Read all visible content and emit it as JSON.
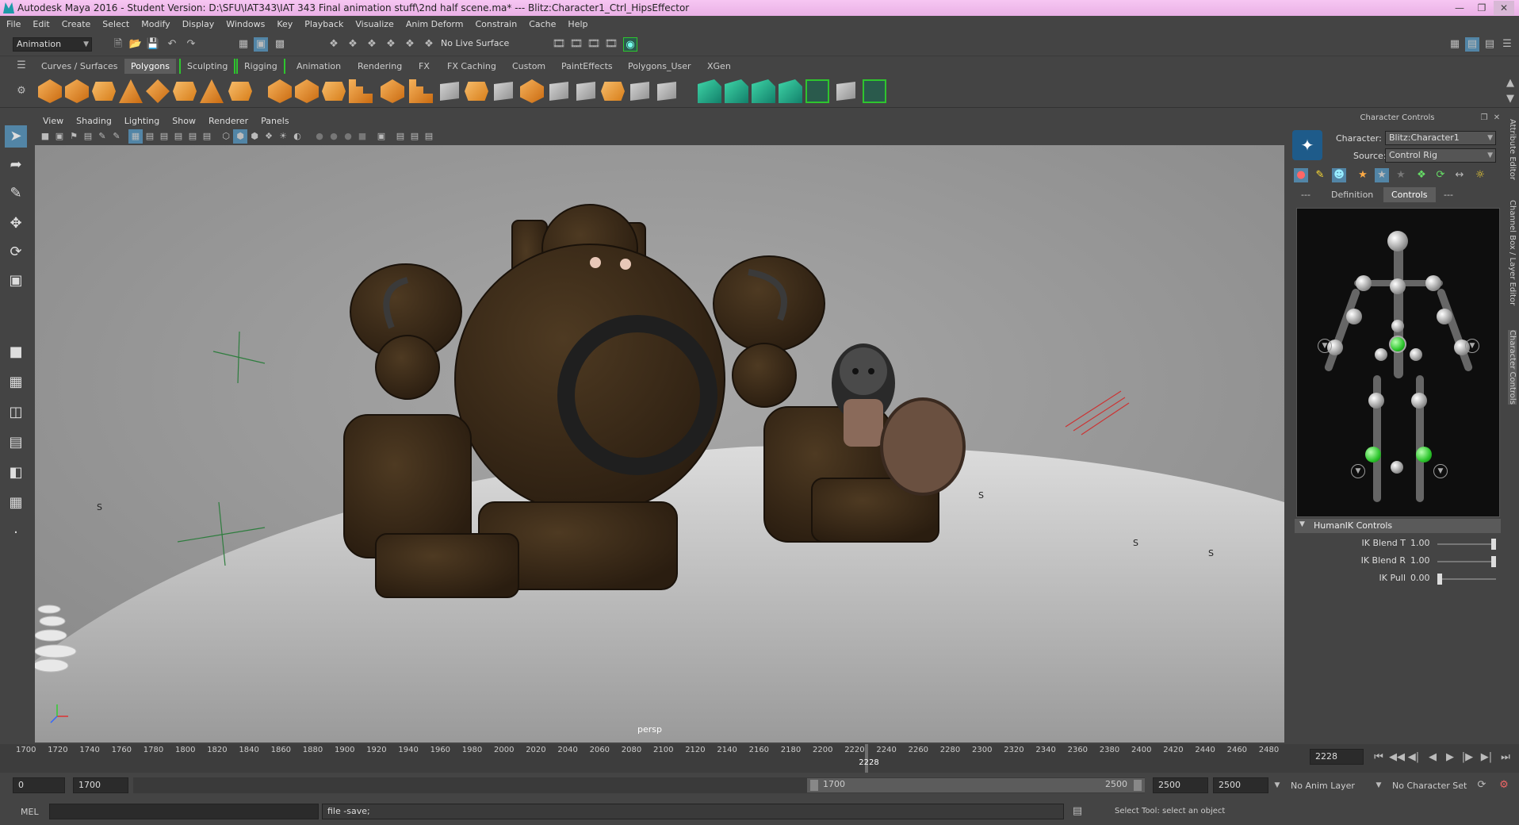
{
  "title": {
    "text": "Autodesk Maya 2016 - Student Version: D:\\SFU\\IAT343\\IAT 343 Final animation stuff\\2nd half scene.ma*   ---   Blitz:Character1_Ctrl_HipsEffector"
  },
  "menu": [
    "File",
    "Edit",
    "Create",
    "Select",
    "Modify",
    "Display",
    "Windows",
    "Key",
    "Playback",
    "Visualize",
    "Anim Deform",
    "Constrain",
    "Cache",
    "Help"
  ],
  "status": {
    "menuset": "Animation",
    "live_surface": "No Live Surface"
  },
  "shelf_tabs": [
    "Curves / Surfaces",
    "Polygons",
    "Sculpting",
    "Rigging",
    "Animation",
    "Rendering",
    "FX",
    "FX Caching",
    "Custom",
    "PaintEffects",
    "Polygons_User",
    "XGen"
  ],
  "shelf_active": "Polygons",
  "viewport": {
    "menu": [
      "View",
      "Shading",
      "Lighting",
      "Show",
      "Renderer",
      "Panels"
    ],
    "camera_label": "persp",
    "scene_markers": [
      "S",
      "S",
      "S",
      "S"
    ]
  },
  "character_controls": {
    "panel_title": "Character Controls",
    "character_label": "Character:",
    "character_value": "Blitz:Character1",
    "source_label": "Source:",
    "source_value": "Control Rig",
    "tabs": [
      "---",
      "Definition",
      "Controls",
      "---"
    ],
    "active_tab": "Controls",
    "section": "HumanIK Controls",
    "sliders": [
      {
        "label": "IK Blend T",
        "value": "1.00",
        "level": 1.0
      },
      {
        "label": "IK Blend R",
        "value": "1.00",
        "level": 1.0
      },
      {
        "label": "IK Pull",
        "value": "0.00",
        "level": 0.0
      }
    ]
  },
  "side_tabs": [
    "Attribute Editor",
    "Channel Box / Layer Editor",
    "Character Controls"
  ],
  "timeline": {
    "ticks": [
      "1700",
      "1720",
      "1740",
      "1760",
      "1780",
      "1800",
      "1820",
      "1840",
      "1860",
      "1880",
      "1900",
      "1920",
      "1940",
      "1960",
      "1980",
      "2000",
      "2020",
      "2040",
      "2060",
      "2080",
      "2100",
      "2120",
      "2140",
      "2160",
      "2180",
      "2200",
      "2220",
      "2240",
      "2260",
      "2280",
      "2300",
      "2320",
      "2340",
      "2360",
      "2380",
      "2400",
      "2420",
      "2440",
      "2460",
      "2480"
    ],
    "current_frame": "2228",
    "current_frame_field": "2228"
  },
  "range": {
    "start": "0",
    "playback_start": "1700",
    "slider_start": "1700",
    "slider_end": "2500",
    "playback_end": "2500",
    "end": "2500",
    "anim_layer": "No Anim Layer",
    "character_set": "No Character Set"
  },
  "command": {
    "mode": "MEL",
    "output": "file -save;",
    "help": "Select Tool: select an object"
  },
  "colors": {
    "titlebar": "#f0bcec",
    "accent": "#5285a6",
    "green": "#2ec52e",
    "shelf_orange": "#e8902a"
  }
}
